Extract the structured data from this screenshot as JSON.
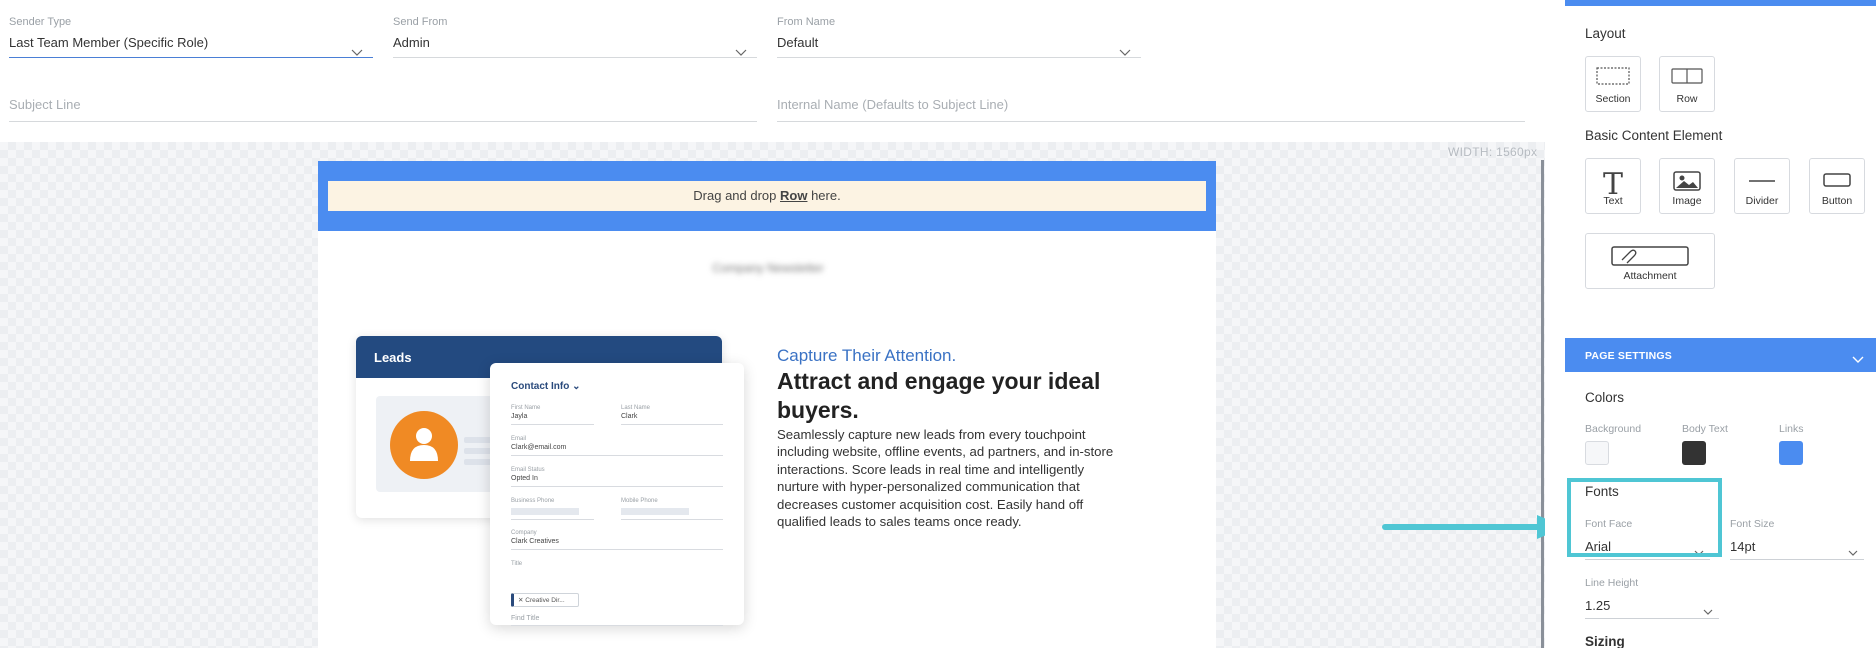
{
  "form": {
    "sender_type": {
      "label": "Sender Type",
      "value": "Last Team Member (Specific Role)"
    },
    "send_from": {
      "label": "Send From",
      "value": "Admin"
    },
    "from_name": {
      "label": "From Name",
      "value": "Default"
    },
    "subject_line": {
      "placeholder": "Subject Line"
    },
    "internal_name": {
      "placeholder": "Internal Name (Defaults to Subject Line)"
    }
  },
  "canvas": {
    "width_label": "WIDTH: 1560px",
    "drop_zone": {
      "prefix": "Drag and drop ",
      "link": "Row",
      "suffix": " here."
    },
    "blurred_title": "Company Newsletter",
    "illustration": {
      "leads_title": "Leads",
      "contact_title": "Contact Info",
      "first_name_label": "First Name",
      "first_name": "Jayla",
      "last_name_label": "Last Name",
      "last_name": "Clark",
      "email_label": "Email",
      "email": "Clark@email.com",
      "email_status_label": "Email Status",
      "email_status": "Opted In",
      "business_phone_label": "Business Phone",
      "mobile_phone_label": "Mobile Phone",
      "company_label": "Company",
      "company": "Clark Creatives",
      "title_label": "Title",
      "title_tag": "Creative Dir...",
      "find_title": "Find Title"
    },
    "kicker": "Capture Their Attention.",
    "headline": "Attract and engage your ideal buyers.",
    "body": "Seamlessly capture new leads from every touchpoint including website, offline events, ad partners, and in-store interactions. Score leads in real time and intelligently nurture with hyper-personalized communication that decreases customer acquisition cost. Easily hand off qualified leads to sales teams once ready."
  },
  "panel": {
    "layout_title": "Layout",
    "layout_items": [
      "Section",
      "Row"
    ],
    "basic_title": "Basic Content Element",
    "basic_items": [
      "Text",
      "Image",
      "Divider",
      "Button"
    ],
    "attachment": "Attachment",
    "page_settings": "PAGE SETTINGS",
    "colors_title": "Colors",
    "colors": {
      "background_label": "Background",
      "background": "#f6f7f9",
      "body_text_label": "Body Text",
      "body_text": "#333333",
      "links_label": "Links",
      "links": "#4b8cf0"
    },
    "fonts_title": "Fonts",
    "font_face_label": "Font Face",
    "font_face": "Arial",
    "font_size_label": "Font Size",
    "font_size": "14pt",
    "line_height_label": "Line Height",
    "line_height": "1.25",
    "sizing_title": "Sizing"
  },
  "colors": {
    "accent": "#4b8cf0",
    "highlight": "#4fc6d4",
    "navy": "#234a80",
    "orange": "#f08a24"
  }
}
